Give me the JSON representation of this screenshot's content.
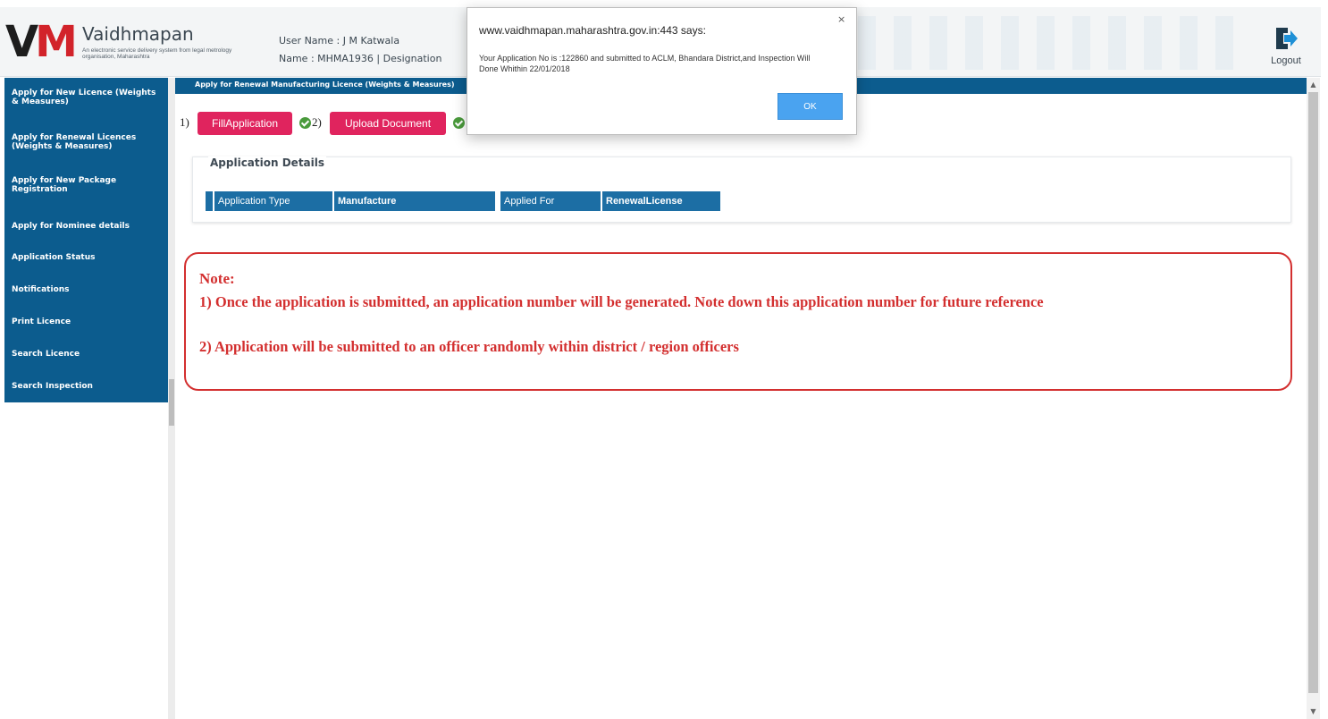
{
  "header": {
    "logo_letters": [
      "V",
      "M"
    ],
    "brand_name": "Vaidhmapan",
    "tagline": "An electronic service delivery system from legal metrology organisation, Maharashtra",
    "user_line": "User Name :  J M Katwala",
    "name_line": "Name : MHMA1936 | Designation",
    "logout_label": "Logout",
    "logout_icon": "logout-icon"
  },
  "sidebar": {
    "items": [
      {
        "label": "Apply for New Licence (Weights & Measures)"
      },
      {
        "label": "Apply for Renewal Licences (Weights & Measures)"
      },
      {
        "label": "Apply for New Package Registration"
      },
      {
        "label": "Apply for Nominee details"
      },
      {
        "label": "Application Status"
      },
      {
        "label": "Notifications"
      },
      {
        "label": "Print Licence"
      },
      {
        "label": "Search Licence"
      },
      {
        "label": "Search Inspection"
      }
    ]
  },
  "main": {
    "title": "Apply for Renewal Manufacturing Licence (Weights & Measures)",
    "steps": [
      {
        "num": "1)",
        "label": "FillApplication"
      },
      {
        "num": "2)",
        "label": "Upload Document"
      }
    ],
    "details": {
      "title": "Application Details",
      "application_type_label": "Application Type",
      "application_type_value": "Manufacture",
      "applied_for_label": "Applied For",
      "applied_for_value": "RenewalLicense"
    },
    "note": {
      "title": "Note:",
      "line1": "1) Once the application is submitted, an application number will be generated. Note down this application number for future reference",
      "line2": "2) Application will be submitted to an officer randomly within district / region officers"
    }
  },
  "dialog": {
    "origin": "www.vaidhmapan.maharashtra.gov.in:443 says:",
    "message": "Your Application No is :122860  and submitted to  ACLM, Bhandara District,and Inspection Will Done Whithin  22/01/2018",
    "ok_label": "OK",
    "close_glyph": "×"
  },
  "colors": {
    "nav_blue": "#0c5c8e",
    "accent_pink": "#e0245e",
    "note_red": "#d32f2f",
    "ok_blue": "#4aa3f0"
  }
}
